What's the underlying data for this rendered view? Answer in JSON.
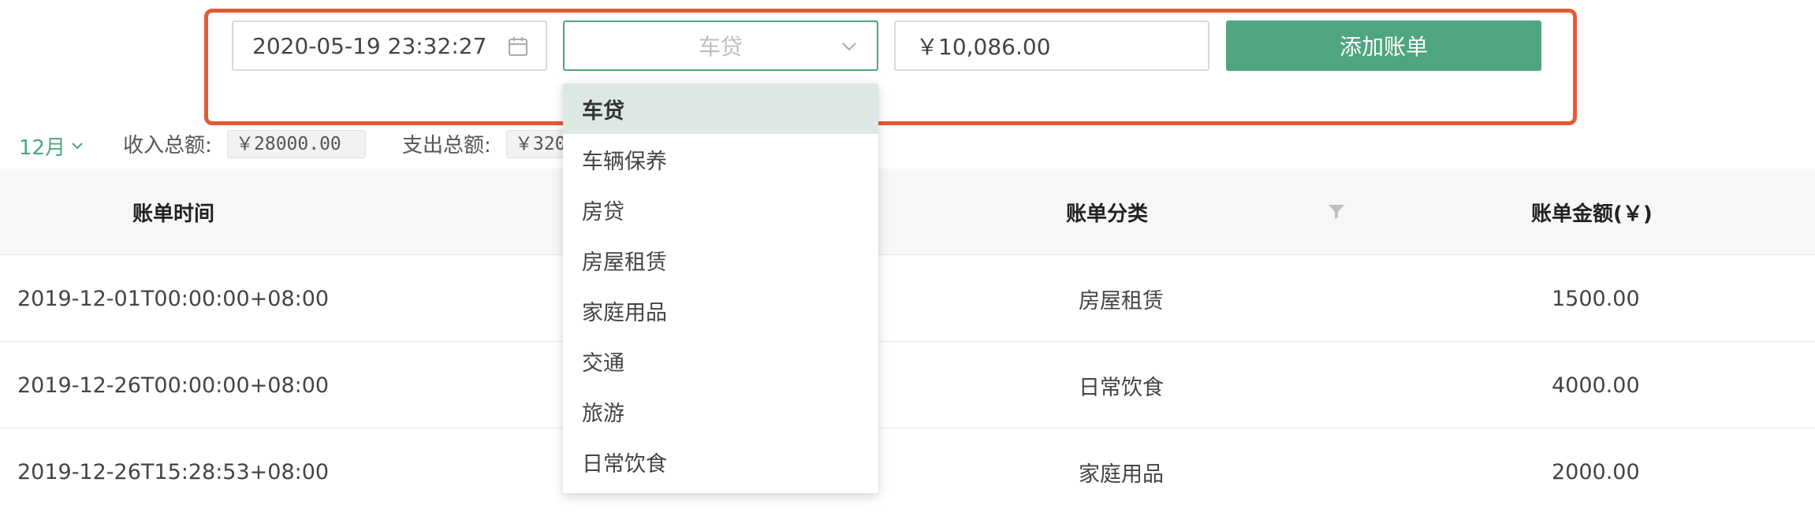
{
  "form": {
    "date_value": "2020-05-19 23:32:27",
    "category_value": "车贷",
    "amount_value": "￥10,086.00",
    "add_button_label": "添加账单"
  },
  "summary": {
    "month": "12月",
    "income_label": "收入总额:",
    "income_value": "￥28000.00",
    "expense_label": "支出总额:",
    "expense_value": "￥320"
  },
  "table": {
    "columns": {
      "time": "账单时间",
      "category": "账单分类",
      "amount": "账单金额(￥)"
    },
    "rows": [
      {
        "time": "2019-12-01T00:00:00+08:00",
        "category": "房屋租赁",
        "amount": "1500.00"
      },
      {
        "time": "2019-12-26T00:00:00+08:00",
        "category": "日常饮食",
        "amount": "4000.00"
      },
      {
        "time": "2019-12-26T15:28:53+08:00",
        "category": "家庭用品",
        "amount": "2000.00"
      }
    ]
  },
  "dropdown": {
    "options": [
      "车贷",
      "车辆保养",
      "房贷",
      "房屋租赁",
      "家庭用品",
      "交通",
      "旅游",
      "日常饮食"
    ],
    "selected_index": 0
  },
  "colors": {
    "accent": "#4fa57e",
    "highlight_border": "#e45a36"
  }
}
